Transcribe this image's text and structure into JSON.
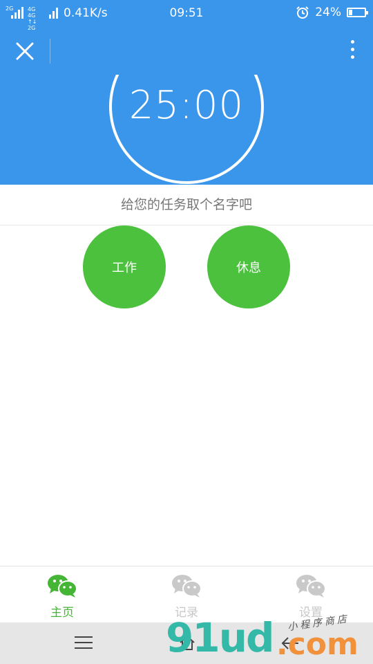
{
  "status_bar": {
    "net1": "2G",
    "net2_top": "4G 4G",
    "net2_bottom": "↑↓ 2G",
    "speed": "0.41K/s",
    "time": "09:51",
    "battery": "24%",
    "battery_level": 0.24
  },
  "timer": {
    "display": "25:00"
  },
  "task_input": {
    "placeholder": "给您的任务取个名字吧"
  },
  "actions": {
    "work": "工作",
    "rest": "休息"
  },
  "tabs": [
    {
      "label": "主页",
      "icon": "wechat-icon",
      "active": true
    },
    {
      "label": "记录",
      "icon": "wechat-icon",
      "active": false
    },
    {
      "label": "设置",
      "icon": "wechat-icon",
      "active": false
    }
  ],
  "watermark": {
    "main": "91ud",
    "com": ".com",
    "sub": "小程序商店"
  },
  "colors": {
    "header_blue": "#3a96ea",
    "button_green": "#4cc13e",
    "tab_active": "#44b534",
    "tab_inactive": "#c7c7c7"
  }
}
